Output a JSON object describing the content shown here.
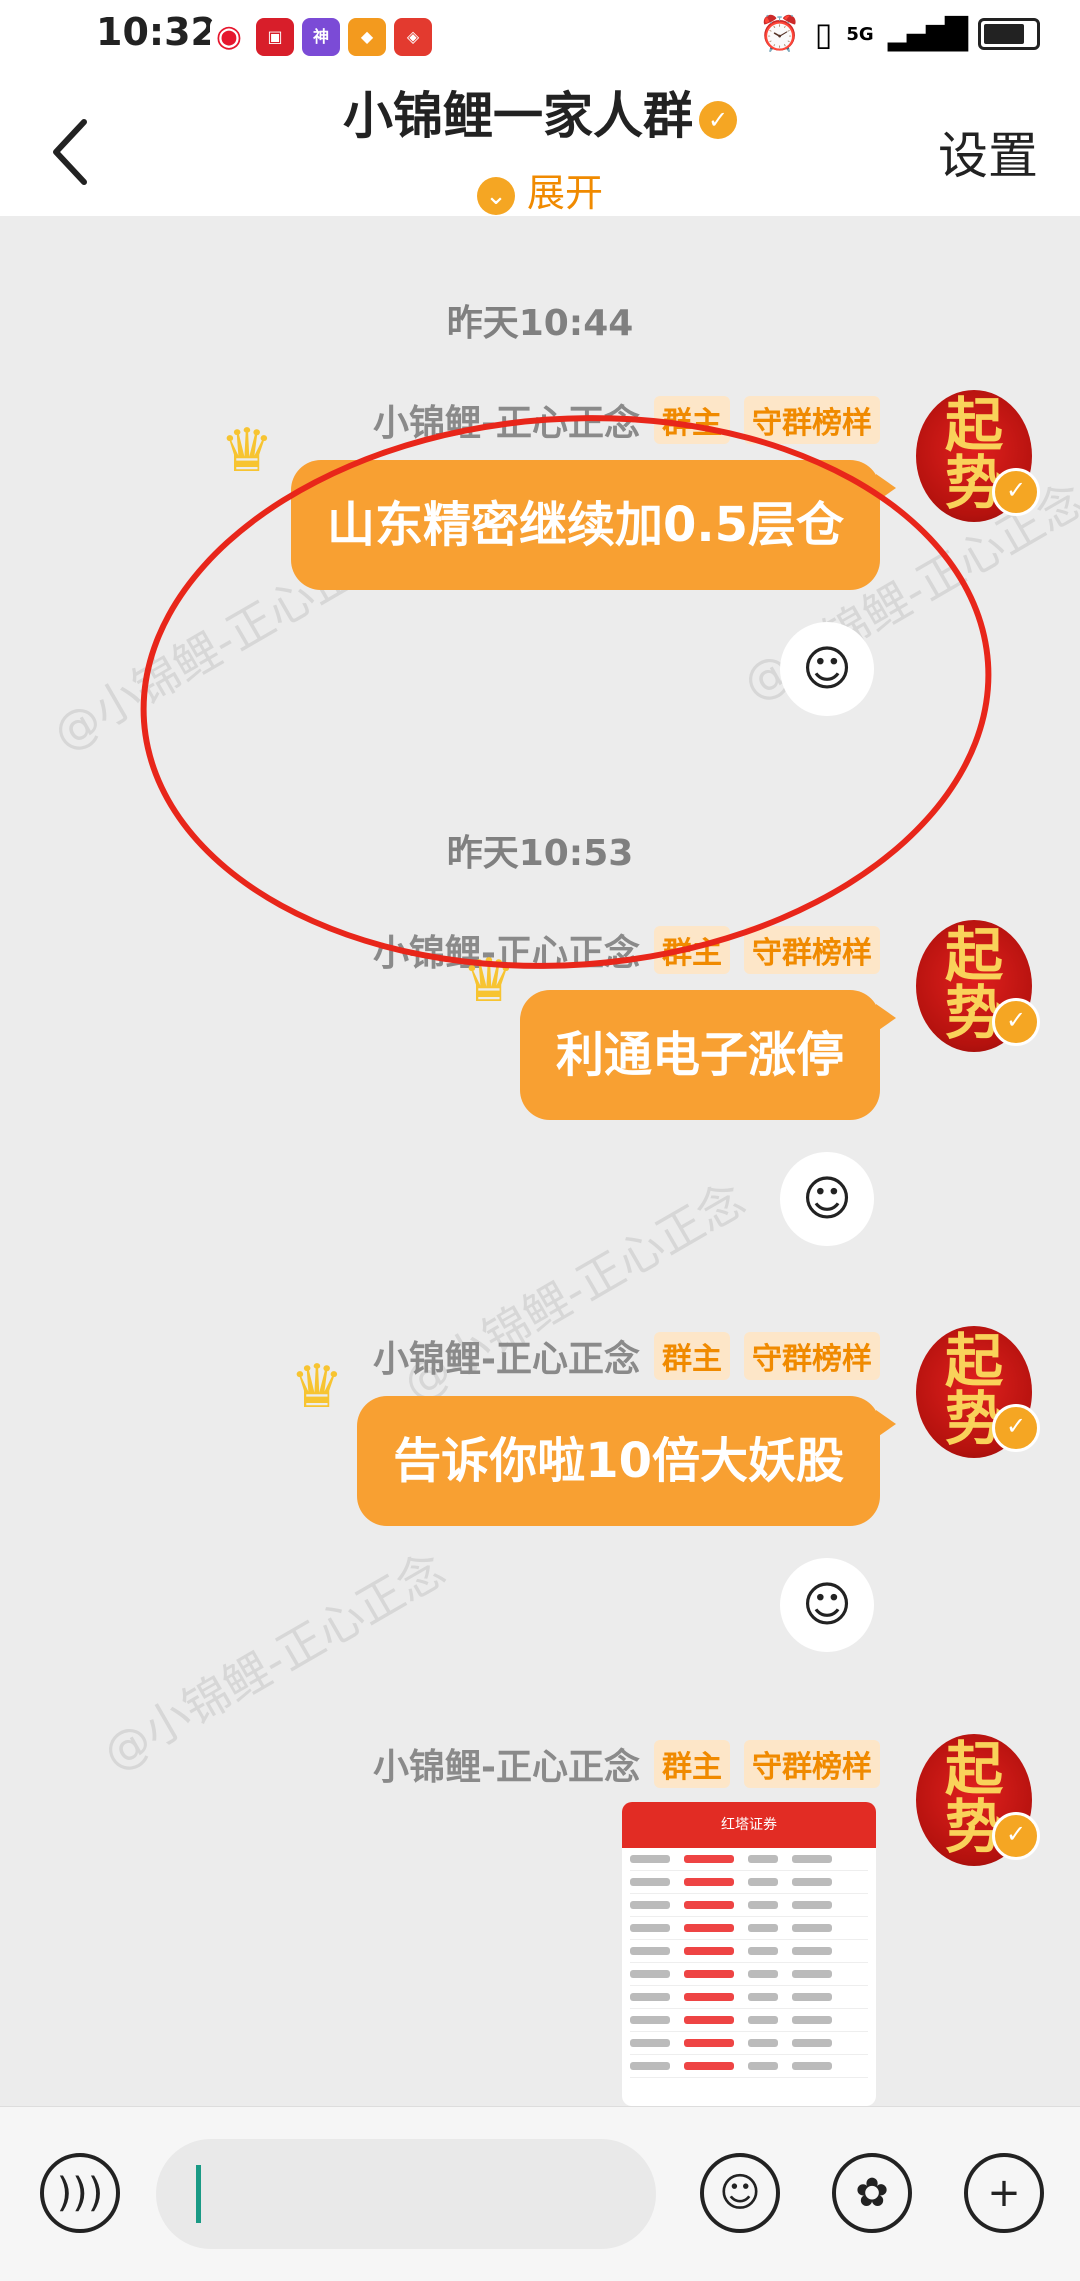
{
  "status_bar": {
    "time": "10:32",
    "signal_text": "5G",
    "apps": [
      "weibo-icon",
      "app-red-icon",
      "shenzhou-app-icon",
      "app-orange-icon",
      "app-red2-icon"
    ]
  },
  "header": {
    "title": "小锦鲤一家人群",
    "expand_label": "展开",
    "settings_label": "设置"
  },
  "messages": [
    {
      "time": "昨天10:44",
      "sender": "小锦鲤-正心正念",
      "tag1": "群主",
      "tag2": "守群榜样",
      "text": "山东精密继续加0.5层仓"
    },
    {
      "time": "昨天10:53",
      "sender": "小锦鲤-正心正念",
      "tag1": "群主",
      "tag2": "守群榜样",
      "text": "利通电子涨停"
    },
    {
      "sender": "小锦鲤-正心正念",
      "tag1": "群主",
      "tag2": "守群榜样",
      "text": "告诉你啦10倍大妖股"
    },
    {
      "sender": "小锦鲤-正心正念",
      "tag1": "群主",
      "tag2": "守群榜样",
      "image_title": "红塔证券"
    }
  ],
  "avatar_text": [
    "起",
    "势"
  ],
  "watermark": "@小锦鲤-正心正念",
  "colors": {
    "bubble": "#f8a032",
    "accent": "#f08a00",
    "annotation_circle": "#e8261a",
    "background": "#ececec"
  }
}
